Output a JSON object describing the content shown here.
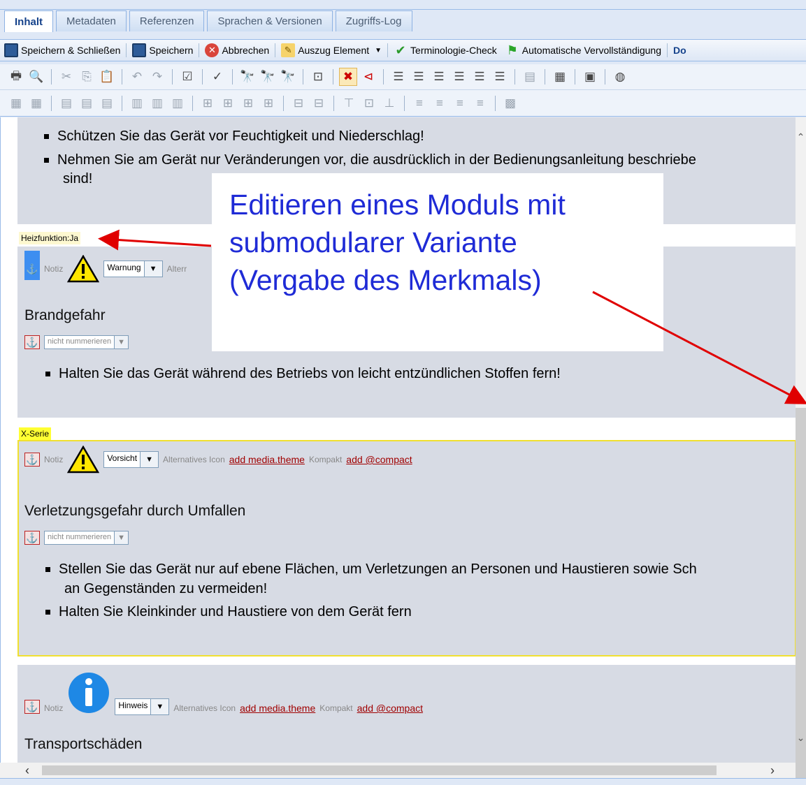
{
  "tabs": [
    {
      "label": "Inhalt",
      "active": true
    },
    {
      "label": "Metadaten"
    },
    {
      "label": "Referenzen"
    },
    {
      "label": "Sprachen & Versionen"
    },
    {
      "label": "Zugriffs-Log"
    }
  ],
  "toolbar": {
    "save_close": "Speichern & Schließen",
    "save": "Speichern",
    "cancel": "Abbrechen",
    "excerpt": "Auszug Element",
    "terminology": "Terminologie-Check",
    "autocomplete": "Automatische Vervollständigung",
    "overflow": "Do"
  },
  "content": {
    "top_bullets": [
      "Schützen Sie das Gerät vor Feuchtigkeit und Niederschlag!",
      "Nehmen Sie am Gerät nur Veränderungen vor, die ausdrücklich in der Bedienungsanleitung beschriebe",
      "sind!"
    ],
    "feature_tag": "Heizfunktion:Ja",
    "module1": {
      "notiz": "Notiz",
      "signal": "Warnung",
      "alt_label": "Alterr",
      "heading": "Brandgefahr",
      "numbering": "nicht nummerieren",
      "bullets": [
        "Halten Sie das Gerät während des Betriebs von leicht entzündlichen Stoffen fern!"
      ]
    },
    "series_tag": "X-Serie",
    "module2": {
      "notiz": "Notiz",
      "signal": "Vorsicht",
      "alt_label": "Alternatives Icon",
      "alt_link": "add media.theme",
      "compact_label": "Kompakt",
      "compact_link": "add @compact",
      "heading": "Verletzungsgefahr durch Umfallen",
      "numbering": "nicht nummerieren",
      "bullet1_line1": "Stellen Sie das Gerät nur auf ebene Flächen, um Verletzungen an Personen und Haustieren sowie Sch",
      "bullet1_line2": "an Gegenständen zu vermeiden!",
      "bullet2": "Halten Sie Kleinkinder und Haustiere von dem Gerät fern"
    },
    "module3": {
      "notiz": "Notiz",
      "signal": "Hinweis",
      "alt_label": "Alternatives Icon",
      "alt_link": "add media.theme",
      "compact_label": "Kompakt",
      "compact_link": "add @compact",
      "heading": "Transportschäden"
    }
  },
  "callout": {
    "line1": "Editieren eines Moduls mit",
    "line2": "submodularer Variante",
    "line3": "(Vergabe des Merkmals)"
  },
  "colors": {
    "callout_text": "#1f2bd6",
    "arrow": "#e00000",
    "series_tag": "#ffff33",
    "module_bg": "#d7dbe4"
  }
}
